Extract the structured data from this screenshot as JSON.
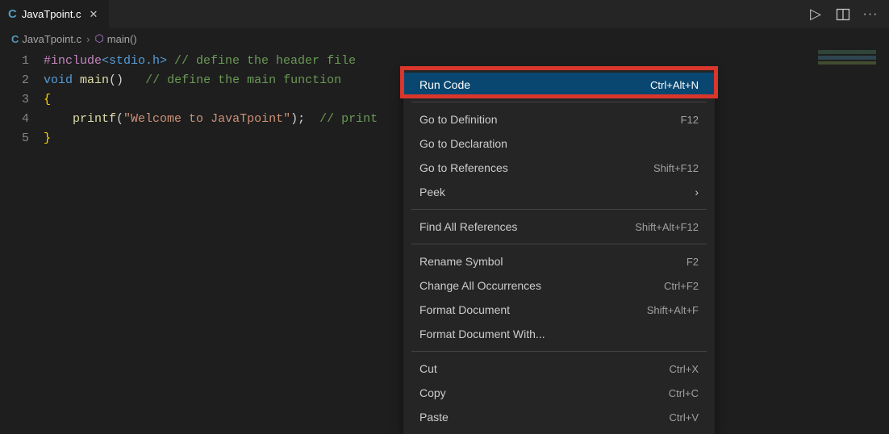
{
  "tab": {
    "icon": "C",
    "label": "JavaTpoint.c"
  },
  "actions": {
    "run": "▷",
    "split": "◫",
    "more": "···"
  },
  "breadcrumb": {
    "file_icon": "C",
    "file": "JavaTpoint.c",
    "chev": "›",
    "fn_icon": "⬡",
    "fn": "main()"
  },
  "gutter": [
    "1",
    "2",
    "3",
    "4",
    "5"
  ],
  "code": {
    "l1": {
      "pp": "#include",
      "ang": "<stdio.h>",
      "cm": " // define the header file"
    },
    "l2": {
      "kw": "void ",
      "fn": "main",
      "pn1": "()",
      "sp": "   ",
      "cm": "// define the main function"
    },
    "l3": {
      "br": "{"
    },
    "l4": {
      "indent": "    ",
      "fn": "printf",
      "pn1": "(",
      "str": "\"Welcome to JavaTpoint\"",
      "pn2": ")",
      "sc": ";",
      "sp": "  ",
      "cm": "// print"
    },
    "l5": {
      "br": "}"
    }
  },
  "menu": {
    "run_code": {
      "label": "Run Code",
      "shortcut": "Ctrl+Alt+N"
    },
    "go_def": {
      "label": "Go to Definition",
      "shortcut": "F12"
    },
    "go_decl": {
      "label": "Go to Declaration",
      "shortcut": ""
    },
    "go_refs": {
      "label": "Go to References",
      "shortcut": "Shift+F12"
    },
    "peek": {
      "label": "Peek",
      "arrow": "›"
    },
    "find_refs": {
      "label": "Find All References",
      "shortcut": "Shift+Alt+F12"
    },
    "rename": {
      "label": "Rename Symbol",
      "shortcut": "F2"
    },
    "change_occ": {
      "label": "Change All Occurrences",
      "shortcut": "Ctrl+F2"
    },
    "fmt_doc": {
      "label": "Format Document",
      "shortcut": "Shift+Alt+F"
    },
    "fmt_with": {
      "label": "Format Document With...",
      "shortcut": ""
    },
    "cut": {
      "label": "Cut",
      "shortcut": "Ctrl+X"
    },
    "copy": {
      "label": "Copy",
      "shortcut": "Ctrl+C"
    },
    "paste": {
      "label": "Paste",
      "shortcut": "Ctrl+V"
    }
  }
}
